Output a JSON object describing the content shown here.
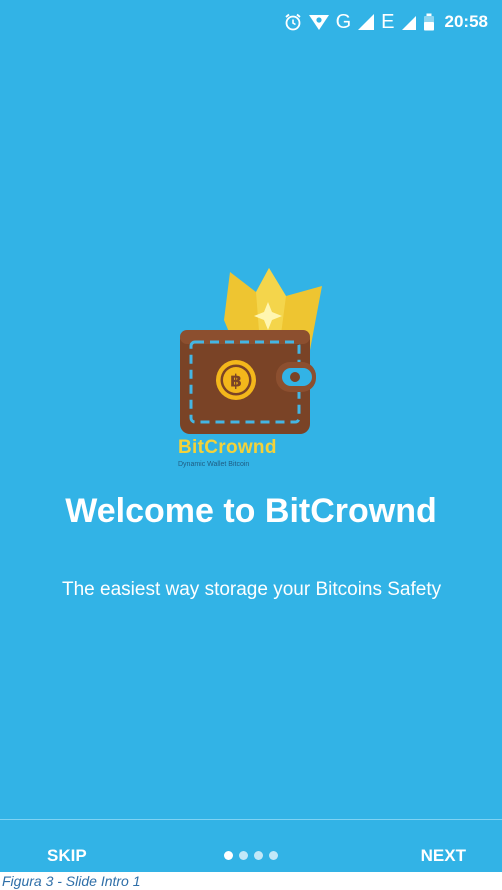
{
  "status_bar": {
    "time": "20:58",
    "network_letter_1": "G",
    "network_letter_2": "E",
    "icons": [
      "alarm-icon",
      "data-saver-icon",
      "signal-icon",
      "signal-icon",
      "battery-icon"
    ]
  },
  "logo": {
    "brand_name": "BitCrownd",
    "tagline": "Dynamic Wallet Bitcoin",
    "icon": "wallet-crown-bitcoin-icon"
  },
  "welcome": {
    "title": "Welcome to BitCrownd",
    "description": "The easiest way storage your Bitcoins Safety"
  },
  "footer": {
    "skip_label": "SKIP",
    "next_label": "NEXT",
    "page_count": 4,
    "current_page": 1
  },
  "caption": "Figura 3 - Slide Intro 1",
  "colors": {
    "background": "#32b3e6",
    "wallet": "#7a4326",
    "crown": "#f3d23a",
    "coin": "#f3b71b"
  }
}
